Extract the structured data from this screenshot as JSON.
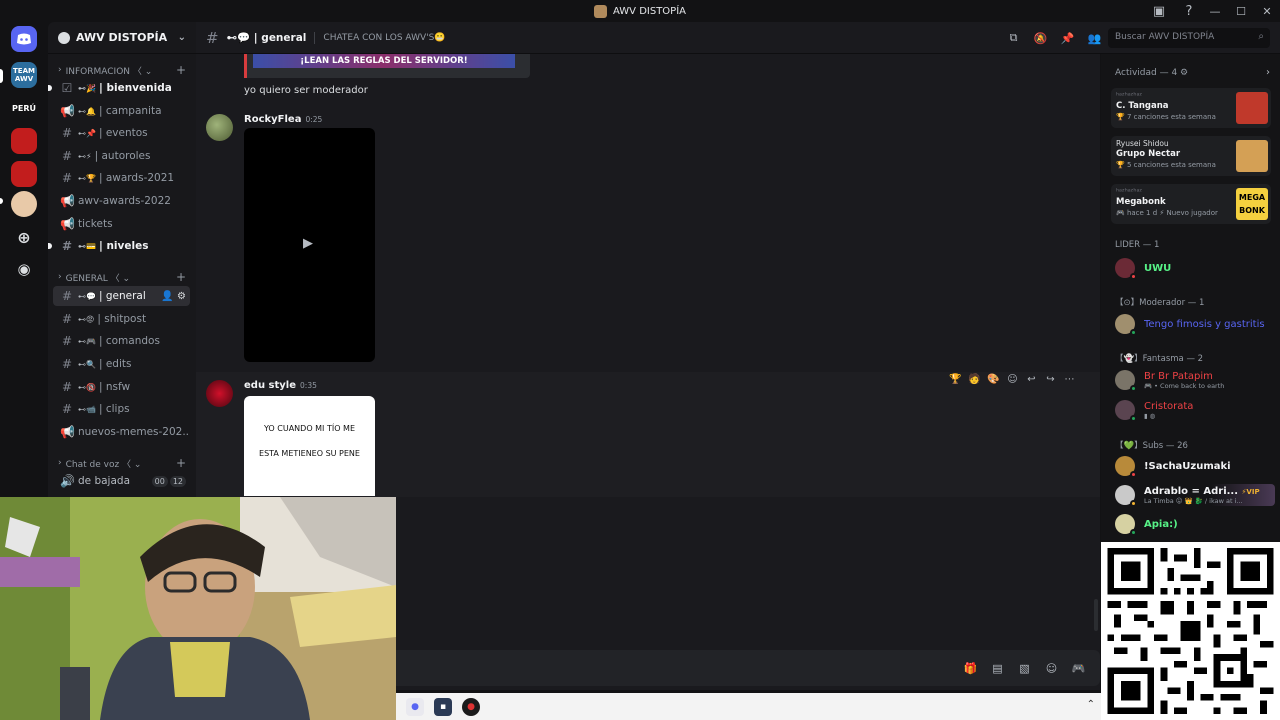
{
  "window": {
    "title": "AWV DISTOPÍA",
    "tool_icons": [
      "inbox-icon",
      "help-icon"
    ],
    "controls": [
      "—",
      "☐",
      "✕"
    ]
  },
  "servers": [
    {
      "name": "discord-home",
      "label": "",
      "color": "#5865f2"
    },
    {
      "name": "team-awv",
      "label": "TEAM AWV",
      "color": "#2c6e9e"
    },
    {
      "name": "peru",
      "label": "PERÚ",
      "color": "#121214"
    },
    {
      "name": "red-server-1",
      "label": "",
      "color": "#c21d1d"
    },
    {
      "name": "red-server-2",
      "label": "",
      "color": "#c21d1d"
    },
    {
      "name": "anime-server",
      "label": "",
      "color": "#e8c9a8"
    }
  ],
  "sidebar": {
    "server_name": "AWV DISTOPÍA",
    "categories": [
      {
        "label": "INFORMACION 〈 ⌄"
      },
      {
        "label": "GENERAL 〈 ⌄"
      },
      {
        "label": "Chat de voz 〈 ⌄"
      }
    ],
    "channels": [
      {
        "emoji": "⊷🎉",
        "name": "| bienvenida",
        "unread": true
      },
      {
        "emoji": "⊷🔔",
        "name": "| campanita",
        "unread": false
      },
      {
        "emoji": "⊷📌",
        "name": "| eventos",
        "unread": false
      },
      {
        "emoji": "⊷⚡",
        "name": "| autoroles",
        "unread": false
      },
      {
        "emoji": "⊷🏆",
        "name": "| awards-2021",
        "unread": false
      },
      {
        "emoji": "",
        "name": "awv-awards-2022",
        "unread": false
      },
      {
        "emoji": "",
        "name": "tickets",
        "unread": false
      },
      {
        "emoji": "⊷💳",
        "name": "| niveles",
        "unread": true
      },
      {
        "emoji": "⊷💬",
        "name": "| general",
        "unread": false
      },
      {
        "emoji": "⊷😡",
        "name": "| shitpost",
        "unread": false
      },
      {
        "emoji": "⊷🎮",
        "name": "| comandos",
        "unread": false
      },
      {
        "emoji": "⊷🔍",
        "name": "| edits",
        "unread": false
      },
      {
        "emoji": "⊷🔞",
        "name": "| nsfw",
        "unread": false
      },
      {
        "emoji": "⊷📹",
        "name": "| clips",
        "unread": false
      },
      {
        "emoji": "",
        "name": "nuevos-memes-202...",
        "unread": false
      }
    ],
    "voice": {
      "name": "de bajada",
      "count_a": "00",
      "count_b": "12"
    }
  },
  "topbar": {
    "channel": "⊷💬 | general",
    "topic": "CHATEA CON LOS AWV'S😬",
    "icons": [
      "threads-icon",
      "mute-bell-icon",
      "pin-icon",
      "members-icon"
    ],
    "search_placeholder": "Buscar AWV DISTOPÍA"
  },
  "chat": {
    "banner_text": "¡LEAN LAS REGLAS DEL SERVIDOR!",
    "messages": [
      {
        "text": "yo quiero ser moderador"
      },
      {
        "author": "RockyFlea",
        "time": "0:25",
        "attachment": "video"
      },
      {
        "author": "edu style",
        "time": "0:35",
        "meme_line1": "YO CUANDO MI TÍO ME",
        "meme_line2": "ESTA METIENEO SU PENE"
      }
    ],
    "hover_actions": [
      "🏆",
      "🧑",
      "🎨",
      "☺",
      "↩",
      "↪",
      "⋯"
    ],
    "composer_icons": [
      "gift-icon",
      "gif-icon",
      "sticker-icon",
      "emoji-icon",
      "gamepad-icon"
    ]
  },
  "members": {
    "activity_header": "Actividad — 4 ⚙",
    "activities": [
      {
        "user": "ʰᵃᶻʰᵃᶻʰᵃᶻ",
        "title": "C. Tangana",
        "detail": "🏆 7 canciones esta semana",
        "art_color": "#c0392b",
        "art_text": ""
      },
      {
        "user": "Ryusei Shidou",
        "title": "Grupo Nectar",
        "detail": "🏆 5 canciones esta semana",
        "art_color": "#d4a055",
        "art_text": ""
      },
      {
        "user": "ʰᵃᶻʰᵃᶻʰᵃᶻ",
        "title": "Megabonk",
        "detail": "🎮 hace 1 d  ⚡ Nuevo jugador",
        "art_color": "#f4d03f",
        "art_text": "MEGA BONK"
      }
    ],
    "groups": [
      {
        "role": "LIDER — 1",
        "members": [
          {
            "name": "UWU",
            "color": "#57f287",
            "status": ""
          }
        ]
      },
      {
        "role": "【⊙】Moderador — 1",
        "members": [
          {
            "name": "Tengo fimosis y gastritis",
            "color": "#5865f2",
            "status": ""
          }
        ]
      },
      {
        "role": "【👻】Fantasma — 2",
        "members": [
          {
            "name": "Br Br Patapim",
            "color": "#ed4245",
            "status": "🎮 • Come back to earth"
          },
          {
            "name": "Cristorata",
            "color": "#ed4245",
            "status": "▮ ◍"
          }
        ]
      },
      {
        "role": "【💚】Subs — 26",
        "members": [
          {
            "name": "!SachaUzumaki",
            "color": "#f2f3f5",
            "status": ""
          },
          {
            "name": "Adrablo = Adri...",
            "color": "#f2f3f5",
            "status": "La Timba 😛 👑 🐉 / ikaw at i...",
            "tag": "⚡VIP"
          },
          {
            "name": "Apia:)",
            "color": "#57f287",
            "status": ""
          }
        ]
      }
    ]
  },
  "taskbar": {
    "apps": [
      "discord-icon",
      "store-icon",
      "obs-icon"
    ],
    "tray": "⌃"
  },
  "colors": {
    "accent": "#5865f2",
    "online": "#23a55a",
    "danger": "#ed4245"
  }
}
